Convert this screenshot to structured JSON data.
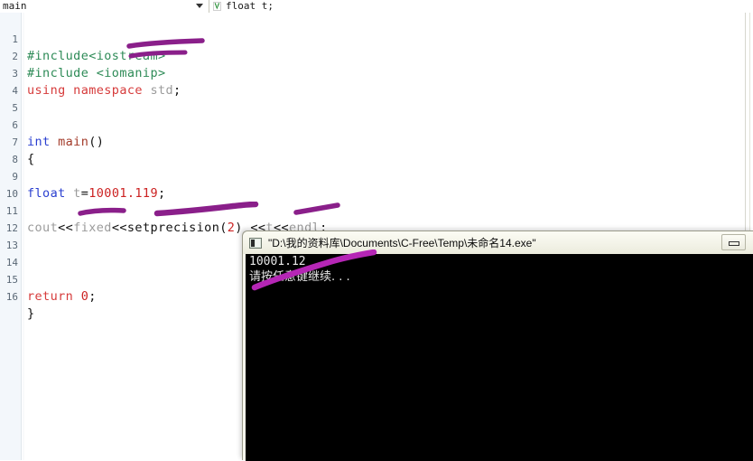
{
  "toolbar": {
    "scope_selector_value": "main",
    "scope_chevron_icon": "chevron-down-icon",
    "symbol_icon": "variable-icon",
    "symbol_value": "float t;"
  },
  "editor": {
    "line_numbers": [
      "1",
      "2",
      "3",
      "4",
      "5",
      "6",
      "7",
      "8",
      "9",
      "10",
      "11",
      "12",
      "13",
      "14",
      "15",
      "16"
    ],
    "lines": [
      {
        "num": "1",
        "text": "#include<iostream>"
      },
      {
        "num": "2",
        "text": "#include <iomanip>"
      },
      {
        "num": "3",
        "text": "using namespace std;"
      },
      {
        "num": "4",
        "text": ""
      },
      {
        "num": "5",
        "text": ""
      },
      {
        "num": "6",
        "text": "int main()"
      },
      {
        "num": "7",
        "text": "{"
      },
      {
        "num": "8",
        "text": ""
      },
      {
        "num": "9",
        "text": "float t=10001.119;"
      },
      {
        "num": "10",
        "text": ""
      },
      {
        "num": "11",
        "text": "cout<<fixed<<setprecision(2) <<t<<endl;"
      },
      {
        "num": "12",
        "text": ""
      },
      {
        "num": "13",
        "text": ""
      },
      {
        "num": "14",
        "text": ""
      },
      {
        "num": "15",
        "text": "return 0;"
      },
      {
        "num": "16",
        "text": "}"
      }
    ],
    "tokens": {
      "l1_pre": "#include<iostream>",
      "l2_pre": "#include <iomanip>",
      "l3_kw": "using namespace ",
      "l3_ident": "std",
      "l3_punct": ";",
      "l6_type": "int ",
      "l6_fn": "main",
      "l6_punct": "()",
      "l7_punct": "{",
      "l9_type": "float ",
      "l9_ident": "t",
      "l9_op": "=",
      "l9_num": "10001.119",
      "l9_punct": ";",
      "l11_a": "cout",
      "l11_b": "<<",
      "l11_c": "fixed",
      "l11_d": "<<",
      "l11_e": "setprecision",
      "l11_f": "(",
      "l11_g": "2",
      "l11_h": ") ",
      "l11_i": "<<",
      "l11_j": "t",
      "l11_k": "<<",
      "l11_l": "endl",
      "l11_m": ";",
      "l15_kw": "return ",
      "l15_num": "0",
      "l15_punct": ";",
      "l16_punct": "}"
    }
  },
  "annotations": {
    "stroke_color": "#8a1f8a",
    "marks": [
      {
        "name": "underline-iomanip"
      },
      {
        "name": "underline-namespace"
      },
      {
        "name": "underline-fixed"
      },
      {
        "name": "underline-setprecision"
      },
      {
        "name": "underline-stream-t"
      },
      {
        "name": "stroke-console-output"
      }
    ]
  },
  "console": {
    "app_icon": "console-app-icon",
    "title": "\"D:\\我的资料库\\Documents\\C-Free\\Temp\\未命名14.exe\"",
    "minimize_icon": "minimize-icon",
    "output_lines": [
      "10001.12",
      "请按任意键继续. . ."
    ]
  },
  "colors": {
    "preprocessor": "#2e8b57",
    "keyword": "#d63b3b",
    "type": "#2a3fd0",
    "function": "#a33b2a",
    "number": "#cc2222",
    "identifier": "#9b9b9b",
    "annotation_purple": "#8a1f8a",
    "console_bg": "#000000",
    "gutter_bg": "#f3f7fb"
  }
}
